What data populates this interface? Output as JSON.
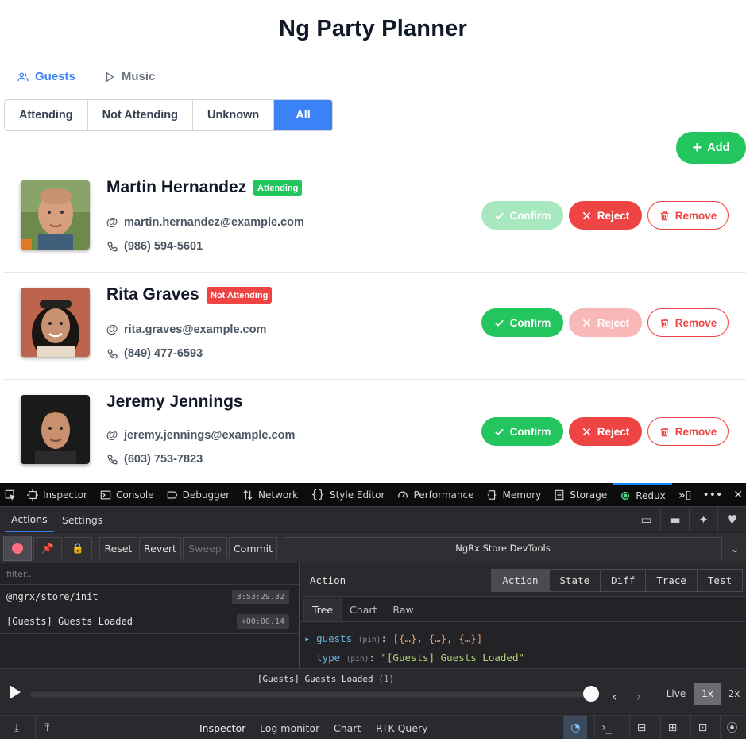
{
  "app": {
    "title": "Ng Party Planner",
    "nav": [
      {
        "label": "Guests",
        "icon": "users-icon",
        "active": true
      },
      {
        "label": "Music",
        "icon": "play-icon",
        "active": false
      }
    ],
    "filters": [
      "Attending",
      "Not Attending",
      "Unknown",
      "All"
    ],
    "active_filter": "All",
    "add_label": "Add",
    "guests": [
      {
        "name": "Martin Hernandez",
        "status": "Attending",
        "email": "martin.hernandez@example.com",
        "phone": "(986) 594-5601",
        "confirm_disabled": true,
        "reject_disabled": false
      },
      {
        "name": "Rita Graves",
        "status": "Not Attending",
        "email": "rita.graves@example.com",
        "phone": "(849) 477-6593",
        "confirm_disabled": false,
        "reject_disabled": true
      },
      {
        "name": "Jeremy Jennings",
        "status": "",
        "email": "jeremy.jennings@example.com",
        "phone": "(603) 753-7823",
        "confirm_disabled": false,
        "reject_disabled": false
      }
    ],
    "buttons": {
      "confirm": "Confirm",
      "reject": "Reject",
      "remove": "Remove"
    }
  },
  "devtools": {
    "tabs": [
      "Inspector",
      "Console",
      "Debugger",
      "Network",
      "Style Editor",
      "Performance",
      "Memory",
      "Storage",
      "Redux"
    ],
    "active_tab": "Redux",
    "redux": {
      "subtabs": [
        "Actions",
        "Settings"
      ],
      "toolbar": {
        "reset": "Reset",
        "revert": "Revert",
        "sweep": "Sweep",
        "commit": "Commit",
        "store_title": "NgRx Store DevTools"
      },
      "filter_placeholder": "filter...",
      "actions": [
        {
          "type": "@ngrx/store/init",
          "time": "3:53:29.32"
        },
        {
          "type": "[Guests] Guests Loaded",
          "time": "+00:00.14"
        }
      ],
      "panel_label": "Action",
      "panel_tabs": [
        "Action",
        "State",
        "Diff",
        "Trace",
        "Test"
      ],
      "view_tabs": [
        "Tree",
        "Chart",
        "Raw"
      ],
      "tree": {
        "guests_key": "guests",
        "guests_pin": "(pin)",
        "guests_value": "[{…}, {…}, {…}]",
        "type_key": "type",
        "type_pin": "(pin)",
        "type_value": "\"[Guests] Guests Loaded\""
      },
      "player": {
        "current_action": "[Guests] Guests Loaded",
        "count": "(1)",
        "speeds": [
          "Live",
          "1x",
          "2x"
        ],
        "active_speed": "1x",
        "position": 1.0
      },
      "bottom_tabs": [
        "Inspector",
        "Log monitor",
        "Chart",
        "RTK Query"
      ],
      "active_bottom_tab": "Inspector"
    }
  }
}
